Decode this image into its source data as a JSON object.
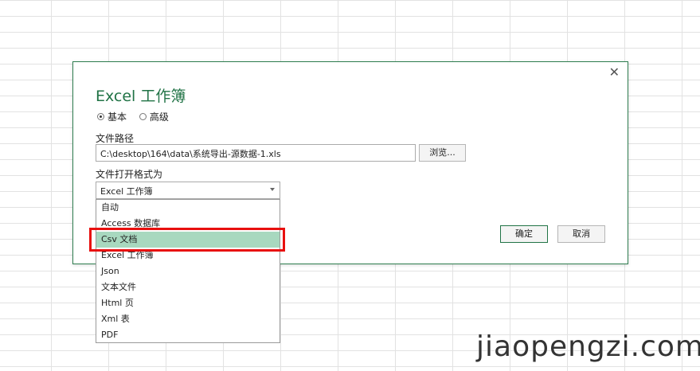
{
  "dialog": {
    "title": "Excel 工作簿",
    "close_glyph": "✕",
    "radio_basic": "基本",
    "radio_advanced": "高级",
    "path_label": "文件路径",
    "path_value": "C:\\desktop\\164\\data\\系统导出-源数据-1.xls",
    "browse_label": "浏览...",
    "format_label": "文件打开格式为",
    "format_selected": "Excel 工作簿",
    "ok_label": "确定",
    "cancel_label": "取消"
  },
  "dropdown": {
    "items": [
      "自动",
      "Access 数据库",
      "Csv 文档",
      "Excel 工作簿",
      "Json",
      "文本文件",
      "Html 页",
      "Xml 表",
      "PDF"
    ],
    "selected_index": 2
  },
  "watermark": "jiaopengzi.com",
  "colors": {
    "accent": "#217346",
    "highlight_border": "#e8100f",
    "selected_bg": "#a8d8bf"
  }
}
